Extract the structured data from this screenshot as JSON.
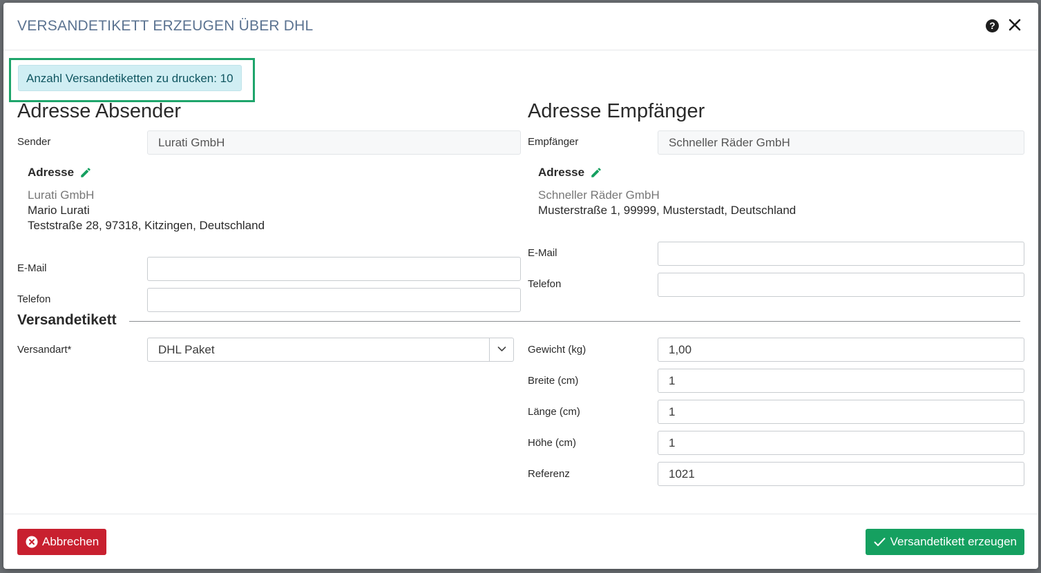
{
  "modal": {
    "title": "VERSANDETIKETT ERZEUGEN ÜBER DHL",
    "help_icon": "question-circle-icon",
    "close_icon": "close-icon"
  },
  "count_badge": "Anzahl Versandetiketten zu drucken: 10",
  "sender": {
    "heading": "Adresse Absender",
    "sender_label": "Sender",
    "sender_value": "Lurati GmbH",
    "address_title": "Adresse",
    "address_company": "Lurati GmbH",
    "address_name": "Mario Lurati",
    "address_street": "Teststraße 28, 97318, Kitzingen, Deutschland",
    "email_label": "E-Mail",
    "email_value": "",
    "phone_label": "Telefon",
    "phone_value": ""
  },
  "recipient": {
    "heading": "Adresse Empfänger",
    "recipient_label": "Empfänger",
    "recipient_value": "Schneller Räder GmbH",
    "address_title": "Adresse",
    "address_company": "Schneller Räder GmbH",
    "address_street": "Musterstraße 1, 99999, Musterstadt, Deutschland",
    "email_label": "E-Mail",
    "email_value": "",
    "phone_label": "Telefon",
    "phone_value": ""
  },
  "label_section": {
    "heading": "Versandetikett",
    "shipping_type_label": "Versandart*",
    "shipping_type_value": "DHL Paket",
    "weight_label": "Gewicht (kg)",
    "weight_value": "1,00",
    "width_label": "Breite (cm)",
    "width_value": "1",
    "length_label": "Länge (cm)",
    "length_value": "1",
    "height_label": "Höhe (cm)",
    "height_value": "1",
    "reference_label": "Referenz",
    "reference_value": "1021"
  },
  "footer": {
    "cancel_label": "Abbrechen",
    "submit_label": "Versandetikett erzeugen"
  },
  "colors": {
    "title": "#5b7391",
    "highlight_border": "#1ea56b",
    "badge_bg": "#d0eef3",
    "cancel": "#c8202f",
    "submit": "#15a060",
    "pencil": "#15a060"
  }
}
